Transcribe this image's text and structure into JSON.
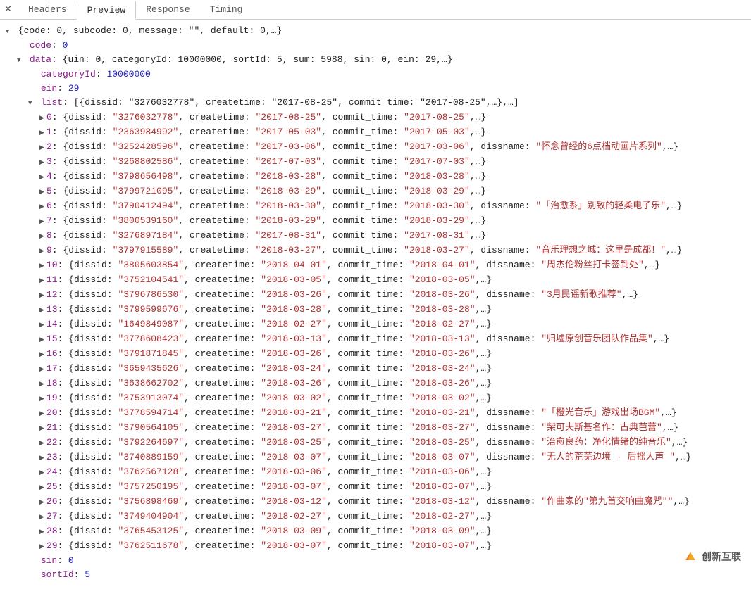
{
  "tabs": {
    "headers": "Headers",
    "preview": "Preview",
    "response": "Response",
    "timing": "Timing",
    "active": "preview"
  },
  "root_summary": "{code: 0, subcode: 0, message: \"\", default: 0,…}",
  "code_label": "code",
  "code_value": "0",
  "data_summary": "{uin: 0, categoryId: 10000000, sortId: 5, sum: 5988, sin: 0, ein: 29,…}",
  "data_keys": {
    "categoryId": {
      "k": "categoryId",
      "v": "10000000"
    },
    "ein": {
      "k": "ein",
      "v": "29"
    },
    "sin": {
      "k": "sin",
      "v": "0"
    },
    "sortId": {
      "k": "sortId",
      "v": "5"
    }
  },
  "list_summary": "[{dissid: \"3276032778\", createtime: \"2017-08-25\", commit_time: \"2017-08-25\",…},…]",
  "list": [
    {
      "i": "0",
      "dissid": "3276032778",
      "createtime": "2017-08-25",
      "commit_time": "2017-08-25"
    },
    {
      "i": "1",
      "dissid": "2363984992",
      "createtime": "2017-05-03",
      "commit_time": "2017-05-03"
    },
    {
      "i": "2",
      "dissid": "3252428596",
      "createtime": "2017-03-06",
      "commit_time": "2017-03-06",
      "dissname": "怀念曾经的6点档动画片系列"
    },
    {
      "i": "3",
      "dissid": "3268802586",
      "createtime": "2017-07-03",
      "commit_time": "2017-07-03"
    },
    {
      "i": "4",
      "dissid": "3798656498",
      "createtime": "2018-03-28",
      "commit_time": "2018-03-28"
    },
    {
      "i": "5",
      "dissid": "3799721095",
      "createtime": "2018-03-29",
      "commit_time": "2018-03-29"
    },
    {
      "i": "6",
      "dissid": "3790412494",
      "createtime": "2018-03-30",
      "commit_time": "2018-03-30",
      "dissname": "「治愈系」别致的轻柔电子乐"
    },
    {
      "i": "7",
      "dissid": "3800539160",
      "createtime": "2018-03-29",
      "commit_time": "2018-03-29"
    },
    {
      "i": "8",
      "dissid": "3276897184",
      "createtime": "2017-08-31",
      "commit_time": "2017-08-31"
    },
    {
      "i": "9",
      "dissid": "3797915589",
      "createtime": "2018-03-27",
      "commit_time": "2018-03-27",
      "dissname": "音乐理想之城：这里是成都！"
    },
    {
      "i": "10",
      "dissid": "3805603854",
      "createtime": "2018-04-01",
      "commit_time": "2018-04-01",
      "dissname": "周杰伦粉丝打卡签到处"
    },
    {
      "i": "11",
      "dissid": "3752104541",
      "createtime": "2018-03-05",
      "commit_time": "2018-03-05"
    },
    {
      "i": "12",
      "dissid": "3796786530",
      "createtime": "2018-03-26",
      "commit_time": "2018-03-26",
      "dissname": "3月民谣新歌推荐"
    },
    {
      "i": "13",
      "dissid": "3799599676",
      "createtime": "2018-03-28",
      "commit_time": "2018-03-28"
    },
    {
      "i": "14",
      "dissid": "1649849087",
      "createtime": "2018-02-27",
      "commit_time": "2018-02-27"
    },
    {
      "i": "15",
      "dissid": "3778608423",
      "createtime": "2018-03-13",
      "commit_time": "2018-03-13",
      "dissname": "归墟原创音乐团队作品集"
    },
    {
      "i": "16",
      "dissid": "3791871845",
      "createtime": "2018-03-26",
      "commit_time": "2018-03-26"
    },
    {
      "i": "17",
      "dissid": "3659435626",
      "createtime": "2018-03-24",
      "commit_time": "2018-03-24"
    },
    {
      "i": "18",
      "dissid": "3638662702",
      "createtime": "2018-03-26",
      "commit_time": "2018-03-26"
    },
    {
      "i": "19",
      "dissid": "3753913074",
      "createtime": "2018-03-02",
      "commit_time": "2018-03-02"
    },
    {
      "i": "20",
      "dissid": "3778594714",
      "createtime": "2018-03-21",
      "commit_time": "2018-03-21",
      "dissname": "「橙光音乐」游戏出场BGM"
    },
    {
      "i": "21",
      "dissid": "3790564105",
      "createtime": "2018-03-27",
      "commit_time": "2018-03-27",
      "dissname": "柴可夫斯基名作：古典芭蕾"
    },
    {
      "i": "22",
      "dissid": "3792264697",
      "createtime": "2018-03-25",
      "commit_time": "2018-03-25",
      "dissname": "治愈良药：净化情绪的纯音乐"
    },
    {
      "i": "23",
      "dissid": "3740889159",
      "createtime": "2018-03-07",
      "commit_time": "2018-03-07",
      "dissname": "无人的荒芜边境 · 后摇人声 "
    },
    {
      "i": "24",
      "dissid": "3762567128",
      "createtime": "2018-03-06",
      "commit_time": "2018-03-06"
    },
    {
      "i": "25",
      "dissid": "3757250195",
      "createtime": "2018-03-07",
      "commit_time": "2018-03-07"
    },
    {
      "i": "26",
      "dissid": "3756898469",
      "createtime": "2018-03-12",
      "commit_time": "2018-03-12",
      "dissname": "作曲家的\"第九首交响曲魔咒\""
    },
    {
      "i": "27",
      "dissid": "3749404904",
      "createtime": "2018-02-27",
      "commit_time": "2018-02-27"
    },
    {
      "i": "28",
      "dissid": "3765453125",
      "createtime": "2018-03-09",
      "commit_time": "2018-03-09"
    },
    {
      "i": "29",
      "dissid": "3762511678",
      "createtime": "2018-03-07",
      "commit_time": "2018-03-07"
    }
  ],
  "watermark": "创新互联"
}
